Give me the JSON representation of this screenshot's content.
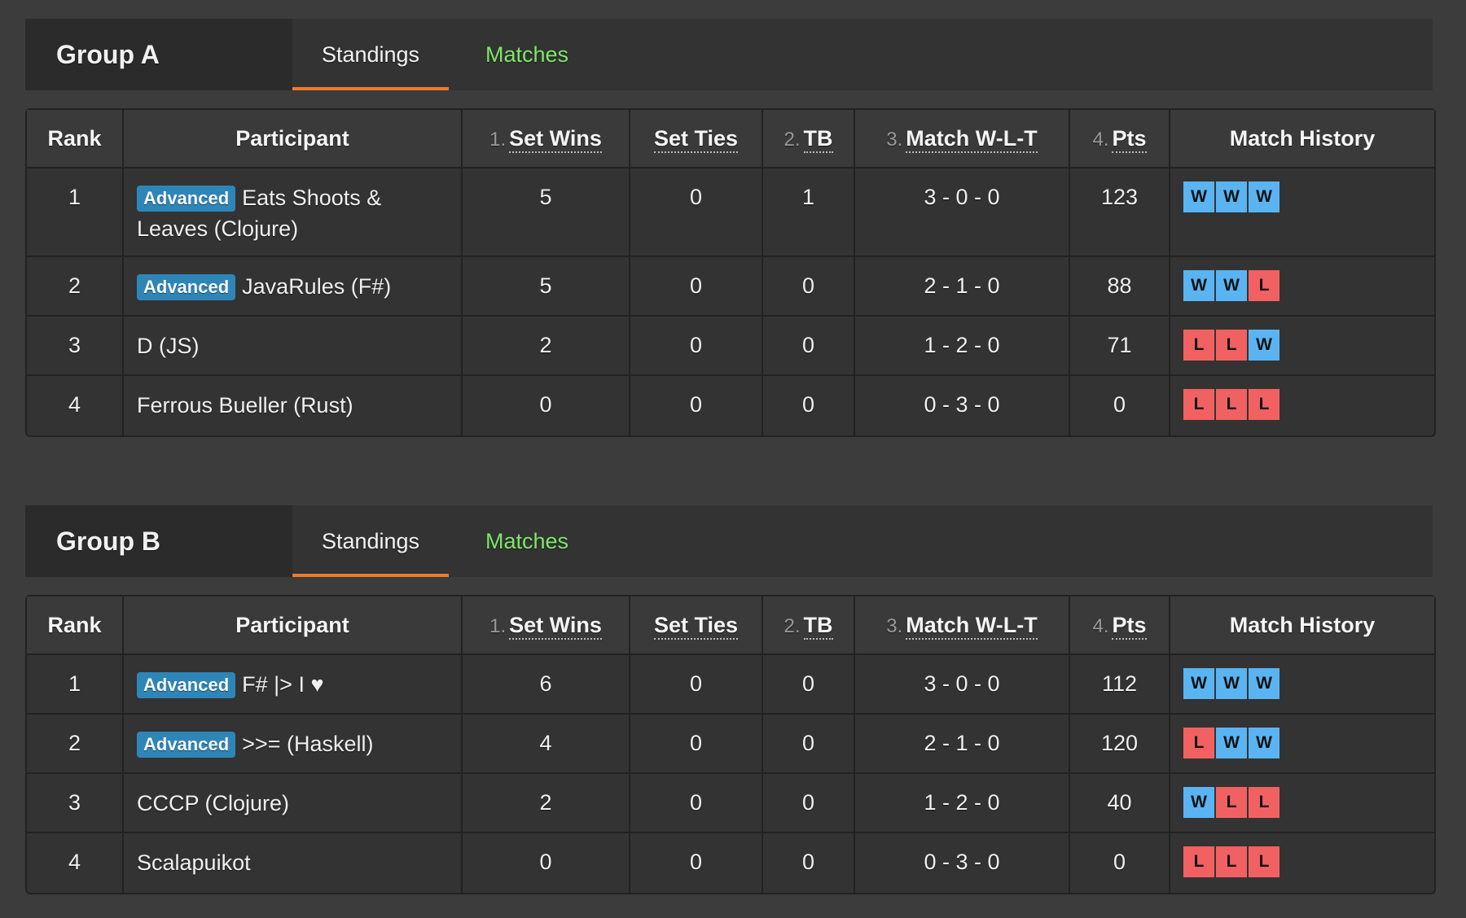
{
  "colors": {
    "win": "#5ab4f2",
    "loss": "#f26161",
    "advanced_badge": "#2e86b8",
    "active_tab_underline": "#ee7a2a",
    "matches_tab": "#7fe86b"
  },
  "columns": {
    "rank": "Rank",
    "participant": "Participant",
    "set_wins_num": "1.",
    "set_wins": "Set Wins",
    "set_ties": "Set Ties",
    "tb_num": "2.",
    "tb": "TB",
    "match_wlt_num": "3.",
    "match_wlt": "Match W-L-T",
    "pts_num": "4.",
    "pts": "Pts",
    "history": "Match History"
  },
  "groups": [
    {
      "title": "Group A",
      "tabs": {
        "standings": "Standings",
        "matches": "Matches"
      },
      "rows": [
        {
          "rank": "1",
          "badge": "Advanced",
          "name": "Eats Shoots & Leaves (Clojure)",
          "set_wins": "5",
          "set_ties": "0",
          "tb": "1",
          "wlt": "3 - 0 - 0",
          "pts": "123",
          "history": [
            "W",
            "W",
            "W"
          ]
        },
        {
          "rank": "2",
          "badge": "Advanced",
          "name": "JavaRules (F#)",
          "set_wins": "5",
          "set_ties": "0",
          "tb": "0",
          "wlt": "2 - 1 - 0",
          "pts": "88",
          "history": [
            "W",
            "W",
            "L"
          ]
        },
        {
          "rank": "3",
          "badge": "",
          "name": "D (JS)",
          "set_wins": "2",
          "set_ties": "0",
          "tb": "0",
          "wlt": "1 - 2 - 0",
          "pts": "71",
          "history": [
            "L",
            "L",
            "W"
          ]
        },
        {
          "rank": "4",
          "badge": "",
          "name": "Ferrous Bueller (Rust)",
          "set_wins": "0",
          "set_ties": "0",
          "tb": "0",
          "wlt": "0 - 3 - 0",
          "pts": "0",
          "history": [
            "L",
            "L",
            "L"
          ]
        }
      ]
    },
    {
      "title": "Group B",
      "tabs": {
        "standings": "Standings",
        "matches": "Matches"
      },
      "rows": [
        {
          "rank": "1",
          "badge": "Advanced",
          "name": "F# |> I ♥",
          "set_wins": "6",
          "set_ties": "0",
          "tb": "0",
          "wlt": "3 - 0 - 0",
          "pts": "112",
          "history": [
            "W",
            "W",
            "W"
          ]
        },
        {
          "rank": "2",
          "badge": "Advanced",
          "name": ">>= (Haskell)",
          "set_wins": "4",
          "set_ties": "0",
          "tb": "0",
          "wlt": "2 - 1 - 0",
          "pts": "120",
          "history": [
            "L",
            "W",
            "W"
          ]
        },
        {
          "rank": "3",
          "badge": "",
          "name": "CCCP (Clojure)",
          "set_wins": "2",
          "set_ties": "0",
          "tb": "0",
          "wlt": "1 - 2 - 0",
          "pts": "40",
          "history": [
            "W",
            "L",
            "L"
          ]
        },
        {
          "rank": "4",
          "badge": "",
          "name": "Scalapuikot",
          "set_wins": "0",
          "set_ties": "0",
          "tb": "0",
          "wlt": "0 - 3 - 0",
          "pts": "0",
          "history": [
            "L",
            "L",
            "L"
          ]
        }
      ]
    }
  ]
}
